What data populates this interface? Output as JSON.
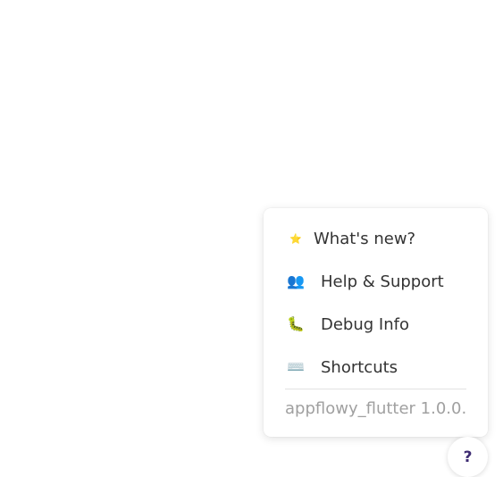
{
  "menu": {
    "items": [
      {
        "label": "What's new?",
        "icon": "star-icon",
        "glyph": "⭐"
      },
      {
        "label": "Help & Support",
        "icon": "people-icon",
        "glyph": "👥"
      },
      {
        "label": "Debug Info",
        "icon": "bug-icon",
        "glyph": "🐛"
      },
      {
        "label": "Shortcuts",
        "icon": "keyboard-icon",
        "glyph": "⌨️"
      }
    ],
    "version": "appflowy_flutter 1.0.0."
  },
  "help_button": {
    "label": "?"
  }
}
